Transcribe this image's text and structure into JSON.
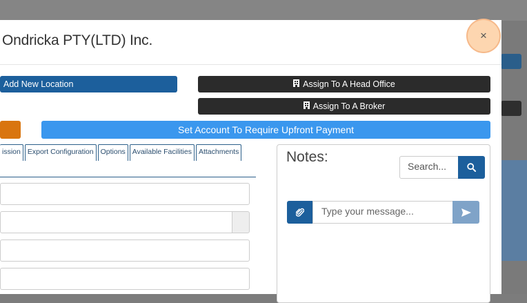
{
  "modal": {
    "title": "Ondricka PTY(LTD) Inc.",
    "close_label": "×"
  },
  "actions": {
    "add_location": "Add New Location",
    "assign_head_office": "Assign To A Head Office",
    "assign_broker": "Assign To A Broker",
    "upfront_payment": "Set Account To Require Upfront Payment"
  },
  "tabs": [
    "ission",
    "Export Configuration",
    "Options",
    "Available Facilities",
    "Attachments"
  ],
  "notes": {
    "title": "Notes:",
    "search_placeholder": "Search...",
    "message_placeholder": "Type your message..."
  },
  "icons": {
    "building": "building-icon",
    "search": "search-icon",
    "paperclip": "paperclip-icon",
    "send": "send-icon",
    "close": "close-icon"
  },
  "colors": {
    "primary": "#1c5f9c",
    "dark": "#2b2b2b",
    "warning": "#d9750f",
    "info": "#3a97ee",
    "close_highlight": "#fdd6b0"
  }
}
